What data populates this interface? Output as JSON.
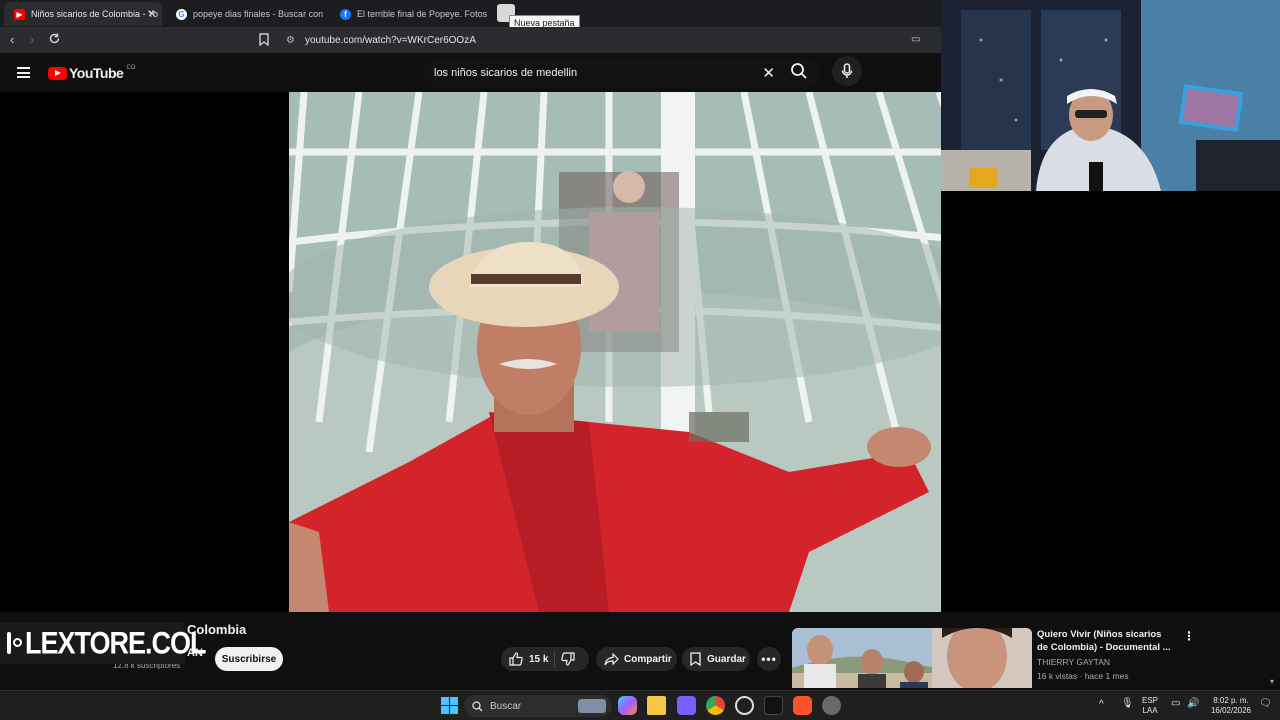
{
  "browser": {
    "tabs": [
      {
        "title": "Niños sicarios de Colombia - Yo",
        "active": true,
        "favicon": "youtube-icon"
      },
      {
        "title": "popeye dias finales - Buscar con Goo",
        "active": false,
        "favicon": "google-icon"
      },
      {
        "title": "El terrible final de Popeye. Fotos Se...",
        "active": false,
        "favicon": "facebook-icon"
      }
    ],
    "tooltip": "Nueva pestaña",
    "url": "youtube.com/watch?v=WKrCer6OOzA"
  },
  "youtube": {
    "logo_text": "YouTube",
    "country_code": "CO",
    "search_query": "los niños sicarios de medellin"
  },
  "video": {
    "title_fragment": "Colombia",
    "channel_fragment": "AN",
    "subscribers": "12.8 k suscriptores",
    "subscribe_label": "Suscribirse",
    "likes": "15 k",
    "share_label": "Compartir",
    "save_label": "Guardar"
  },
  "watermark": {
    "text": "LEXTORE.COL"
  },
  "recommended": {
    "title": "Quiero Vivir (Niños sicarios de Colombia) - Documental ...",
    "channel": "THIERRY GAYTAN",
    "meta": "16 k vistas · hace 1 mes"
  },
  "taskbar": {
    "search_label": "Buscar",
    "lang_top": "ESP",
    "lang_bottom": "LAA",
    "time": "8:02 p. m.",
    "date": "16/02/2026"
  }
}
